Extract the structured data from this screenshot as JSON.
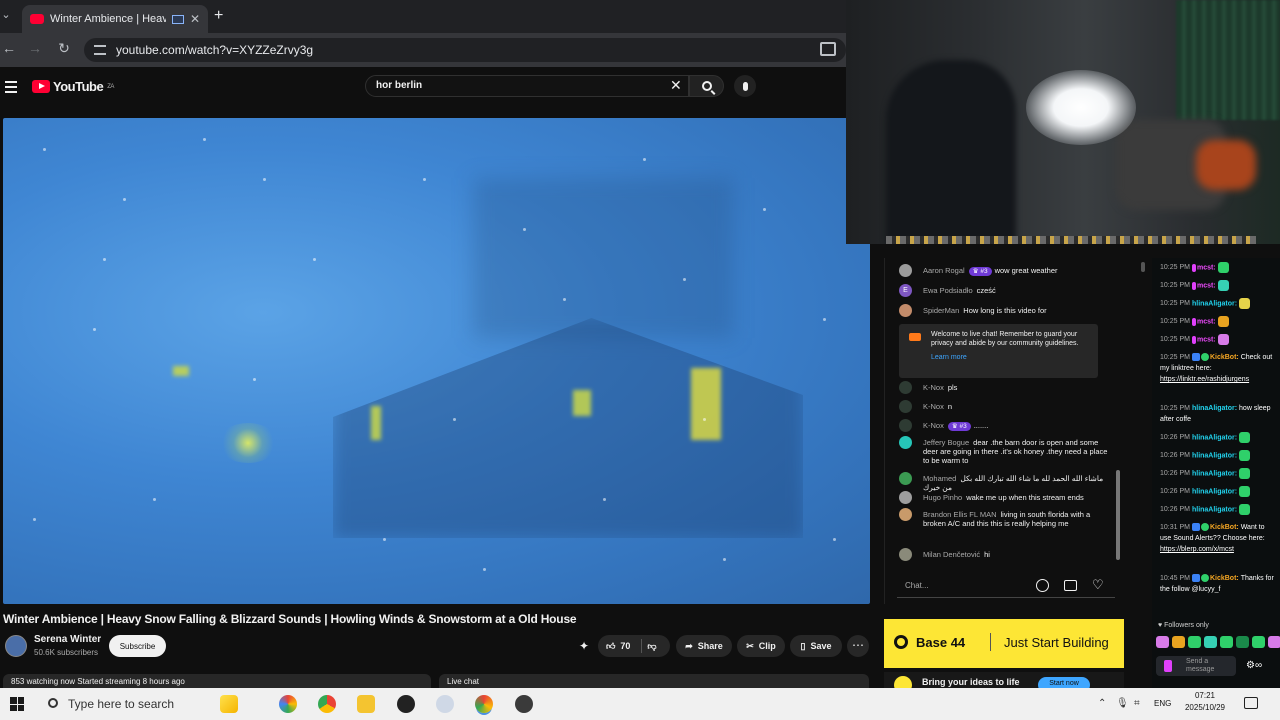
{
  "browser": {
    "tab_title": "Winter Ambience | Heavy Sn",
    "new_tab": "+",
    "close_tab": "✕",
    "url": "youtube.com/watch?v=XYZZeZrvy3g"
  },
  "youtube": {
    "logo_text": "YouTube",
    "region": "ZA",
    "search_value": "hor berlin",
    "video_title": "Winter Ambience | Heavy Snow Falling & Blizzard Sounds | Howling Winds & Snowstorm at a Old House",
    "channel_name": "Serena Winter",
    "subscribers": "50.6K subscribers",
    "subscribe_label": "Subscribe",
    "like_count": "70",
    "share_label": "Share",
    "clip_label": "Clip",
    "save_label": "Save",
    "watching_text": "853 watching now  Started streaming 8 hours ago",
    "live_chat_label": "Live chat"
  },
  "live_chat": {
    "messages": [
      {
        "author": "Aaron Rogal",
        "badge": "#3",
        "text": "wow great weather",
        "color": "#9c9c9c"
      },
      {
        "author": "Ewa Podsiadło",
        "text": "cześć",
        "initial": "E",
        "color": "#7e57c2"
      },
      {
        "author": "SpiderMan",
        "text": "How long is this video for",
        "color": "#c28b6a"
      },
      {
        "author": "K-Nox",
        "text": "pls",
        "color": "#2e3b33"
      },
      {
        "author": "K-Nox",
        "text": "n",
        "color": "#2e3b33"
      },
      {
        "author": "K-Nox",
        "badge": "#3",
        "text": ".......",
        "color": "#2e3b33"
      },
      {
        "author": "Jeffery Bogue",
        "text": "dear .the barn door is open and some deer are going in there .it's ok honey .they need a place to be warm to",
        "color": "#26c6b8"
      },
      {
        "author": "Mohamed",
        "text": "ماشاء الله الحمد لله ما شاء الله تبارك الله بكل من خيرك",
        "color": "#3b9a52"
      },
      {
        "author": "Hugo Pinho",
        "text": "wake me up when this stream ends",
        "color": "#9e9e9e"
      },
      {
        "author": "Brandon Ellis FL MAN",
        "text": "living in south florida with a broken A/C and this this is really helping me",
        "color": "#c89a6a"
      },
      {
        "author": "Milan Denčetović",
        "text": "hi",
        "color": "#8a8a7a"
      }
    ],
    "notice_text": "Welcome to live chat! Remember to guard your privacy and abide by our community guidelines.",
    "learn_more": "Learn more",
    "input_placeholder": "Chat..."
  },
  "ad": {
    "brand": "Base 44",
    "tagline": "Just Start Building",
    "subline": "Bring your ideas to life",
    "cta": "Start now"
  },
  "kick_chat": {
    "messages": [
      {
        "time": "10:25 PM",
        "user": "mcst",
        "user_color": "#f04bff",
        "text": "",
        "emote_color": "#2fd06a"
      },
      {
        "time": "10:25 PM",
        "user": "mcst",
        "user_color": "#f04bff",
        "text": "",
        "emote_color": "#36d0b4"
      },
      {
        "time": "10:25 PM",
        "user": "hlinaAligator",
        "user_color": "#22d3ee",
        "text": "",
        "emote_color": "#e6d34a"
      },
      {
        "time": "10:25 PM",
        "user": "mcst",
        "user_color": "#f04bff",
        "text": "",
        "emote_color": "#e8a320"
      },
      {
        "time": "10:25 PM",
        "user": "mcst",
        "user_color": "#f04bff",
        "text": "",
        "emote_color": "#d77be8"
      },
      {
        "time": "10:25 PM",
        "user": "KickBot",
        "user_color": "#f5a623",
        "text": "Check out my linktree here: ",
        "link": "https://linktr.ee/rashidjurgens"
      },
      {
        "time": "10:25 PM",
        "user": "hlinaAligator",
        "user_color": "#22d3ee",
        "text": "how sleep after coffe"
      },
      {
        "time": "10:26 PM",
        "user": "hlinaAligator",
        "user_color": "#22d3ee",
        "text": "",
        "emote_color": "#2fd06a"
      },
      {
        "time": "10:26 PM",
        "user": "hlinaAligator",
        "user_color": "#22d3ee",
        "text": "",
        "emote_color": "#2fd06a"
      },
      {
        "time": "10:26 PM",
        "user": "hlinaAligator",
        "user_color": "#22d3ee",
        "text": "",
        "emote_color": "#2fd06a"
      },
      {
        "time": "10:26 PM",
        "user": "hlinaAligator",
        "user_color": "#22d3ee",
        "text": "",
        "emote_color": "#2fd06a"
      },
      {
        "time": "10:26 PM",
        "user": "hlinaAligator",
        "user_color": "#22d3ee",
        "text": "",
        "emote_color": "#2fd06a"
      },
      {
        "time": "10:31 PM",
        "user": "KickBot",
        "user_color": "#f5a623",
        "text": "Want to use Sound Alerts?? Choose here: ",
        "link": "https://blerp.com/x/mcst"
      },
      {
        "time": "10:45 PM",
        "user": "KickBot",
        "user_color": "#f5a623",
        "text": "Thanks for the follow @lucyy_f"
      }
    ],
    "followers_only": "♥ Followers only",
    "input_placeholder": "Send a message"
  },
  "taskbar": {
    "search_placeholder": "Type here to search",
    "language": "ENG",
    "time": "07:21",
    "date": "2025/10/29"
  }
}
